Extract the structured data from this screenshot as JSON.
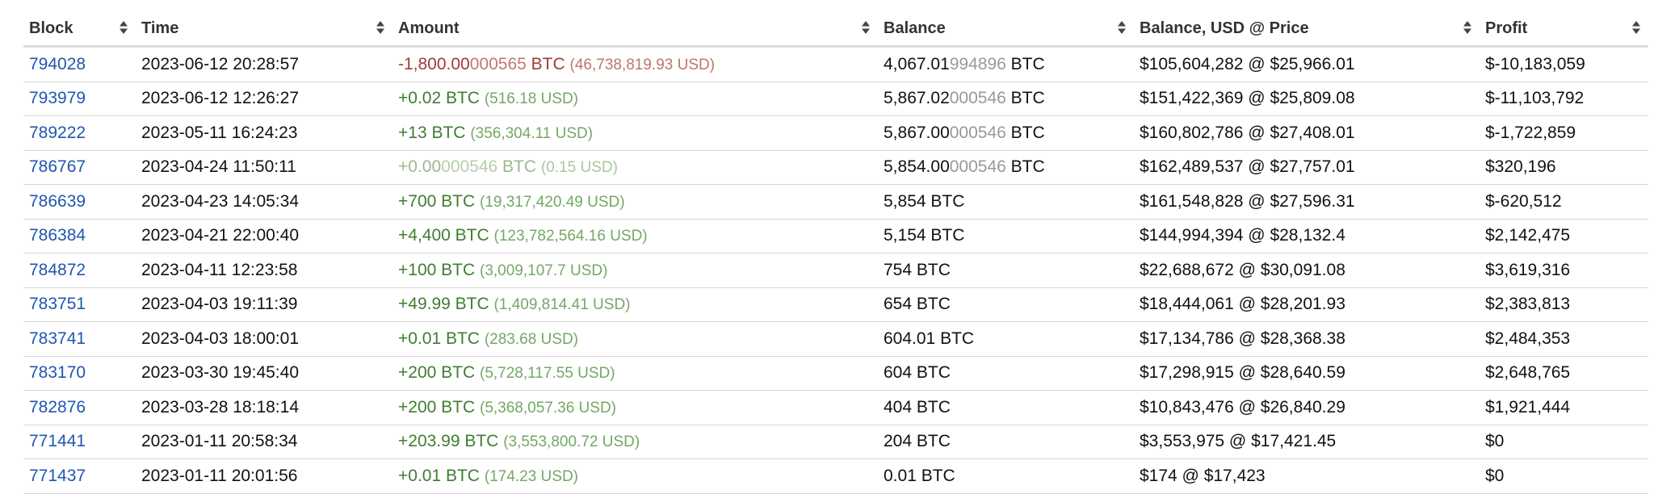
{
  "columns": [
    {
      "label": "Block"
    },
    {
      "label": "Time"
    },
    {
      "label": "Amount"
    },
    {
      "label": "Balance"
    },
    {
      "label": "Balance, USD @ Price"
    },
    {
      "label": "Profit"
    }
  ],
  "rows": [
    {
      "block": "794028",
      "time": "2023-06-12 20:28:57",
      "amt_main": "-1,800.00",
      "amt_dim": "000565",
      "amt_unit": " BTC",
      "amt_usd": "(46,738,819.93 USD)",
      "amt_type": "neg",
      "bal_main": "4,067.01",
      "bal_dim": "994896",
      "bal_unit": " BTC",
      "bal_usd": "$105,604,282 @ $25,966.01",
      "profit": "$-10,183,059"
    },
    {
      "block": "793979",
      "time": "2023-06-12 12:26:27",
      "amt_main": "+0.02",
      "amt_dim": "",
      "amt_unit": " BTC",
      "amt_usd": "(516.18 USD)",
      "amt_type": "pos",
      "bal_main": "5,867.02",
      "bal_dim": "000546",
      "bal_unit": " BTC",
      "bal_usd": "$151,422,369 @ $25,809.08",
      "profit": "$-11,103,792"
    },
    {
      "block": "789222",
      "time": "2023-05-11 16:24:23",
      "amt_main": "+13",
      "amt_dim": "",
      "amt_unit": " BTC",
      "amt_usd": "(356,304.11 USD)",
      "amt_type": "pos",
      "bal_main": "5,867.00",
      "bal_dim": "000546",
      "bal_unit": " BTC",
      "bal_usd": "$160,802,786 @ $27,408.01",
      "profit": "$-1,722,859"
    },
    {
      "block": "786767",
      "time": "2023-04-24 11:50:11",
      "amt_main": "+0.00",
      "amt_dim": "000546",
      "amt_unit": " BTC",
      "amt_usd": "(0.15 USD)",
      "amt_type": "faint",
      "bal_main": "5,854.00",
      "bal_dim": "000546",
      "bal_unit": " BTC",
      "bal_usd": "$162,489,537 @ $27,757.01",
      "profit": "$320,196"
    },
    {
      "block": "786639",
      "time": "2023-04-23 14:05:34",
      "amt_main": "+700",
      "amt_dim": "",
      "amt_unit": " BTC",
      "amt_usd": "(19,317,420.49 USD)",
      "amt_type": "pos",
      "bal_main": "5,854",
      "bal_dim": "",
      "bal_unit": " BTC",
      "bal_usd": "$161,548,828 @ $27,596.31",
      "profit": "$-620,512"
    },
    {
      "block": "786384",
      "time": "2023-04-21 22:00:40",
      "amt_main": "+4,400",
      "amt_dim": "",
      "amt_unit": " BTC",
      "amt_usd": "(123,782,564.16 USD)",
      "amt_type": "pos",
      "bal_main": "5,154",
      "bal_dim": "",
      "bal_unit": " BTC",
      "bal_usd": "$144,994,394 @ $28,132.4",
      "profit": "$2,142,475"
    },
    {
      "block": "784872",
      "time": "2023-04-11 12:23:58",
      "amt_main": "+100",
      "amt_dim": "",
      "amt_unit": " BTC",
      "amt_usd": "(3,009,107.7 USD)",
      "amt_type": "pos",
      "bal_main": "754",
      "bal_dim": "",
      "bal_unit": " BTC",
      "bal_usd": "$22,688,672 @ $30,091.08",
      "profit": "$3,619,316"
    },
    {
      "block": "783751",
      "time": "2023-04-03 19:11:39",
      "amt_main": "+49.99",
      "amt_dim": "",
      "amt_unit": " BTC",
      "amt_usd": "(1,409,814.41 USD)",
      "amt_type": "pos",
      "bal_main": "654",
      "bal_dim": "",
      "bal_unit": " BTC",
      "bal_usd": "$18,444,061 @ $28,201.93",
      "profit": "$2,383,813"
    },
    {
      "block": "783741",
      "time": "2023-04-03 18:00:01",
      "amt_main": "+0.01",
      "amt_dim": "",
      "amt_unit": " BTC",
      "amt_usd": "(283.68 USD)",
      "amt_type": "pos",
      "bal_main": "604.01",
      "bal_dim": "",
      "bal_unit": " BTC",
      "bal_usd": "$17,134,786 @ $28,368.38",
      "profit": "$2,484,353"
    },
    {
      "block": "783170",
      "time": "2023-03-30 19:45:40",
      "amt_main": "+200",
      "amt_dim": "",
      "amt_unit": " BTC",
      "amt_usd": "(5,728,117.55 USD)",
      "amt_type": "pos",
      "bal_main": "604",
      "bal_dim": "",
      "bal_unit": " BTC",
      "bal_usd": "$17,298,915 @ $28,640.59",
      "profit": "$2,648,765"
    },
    {
      "block": "782876",
      "time": "2023-03-28 18:18:14",
      "amt_main": "+200",
      "amt_dim": "",
      "amt_unit": " BTC",
      "amt_usd": "(5,368,057.36 USD)",
      "amt_type": "pos",
      "bal_main": "404",
      "bal_dim": "",
      "bal_unit": " BTC",
      "bal_usd": "$10,843,476 @ $26,840.29",
      "profit": "$1,921,444"
    },
    {
      "block": "771441",
      "time": "2023-01-11 20:58:34",
      "amt_main": "+203.99",
      "amt_dim": "",
      "amt_unit": " BTC",
      "amt_usd": "(3,553,800.72 USD)",
      "amt_type": "pos",
      "bal_main": "204",
      "bal_dim": "",
      "bal_unit": " BTC",
      "bal_usd": "$3,553,975 @ $17,421.45",
      "profit": "$0"
    },
    {
      "block": "771437",
      "time": "2023-01-11 20:01:56",
      "amt_main": "+0.01",
      "amt_dim": "",
      "amt_unit": " BTC",
      "amt_usd": "(174.23 USD)",
      "amt_type": "pos",
      "bal_main": "0.01",
      "bal_dim": "",
      "bal_unit": " BTC",
      "bal_usd": "$174 @ $17,423",
      "profit": "$0"
    }
  ],
  "colors": {
    "link": "#1f57b0",
    "positive": "#3f7d32",
    "negative": "#a33a32",
    "header_border": "#dcdcdc",
    "row_border": "#d6d6d6"
  }
}
